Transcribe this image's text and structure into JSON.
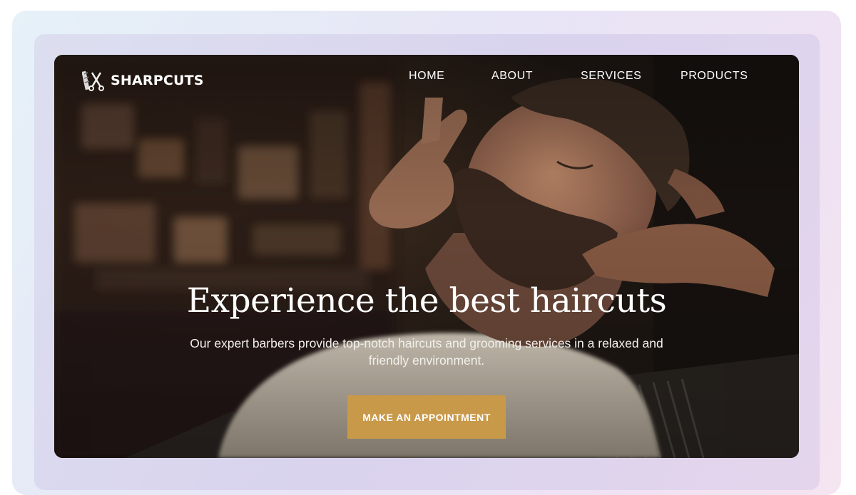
{
  "brand": {
    "name": "SHARPCUTS",
    "icon": "barber-scissors-icon"
  },
  "nav": {
    "items": [
      "HOME",
      "ABOUT",
      "SERVICES",
      "PRODUCTS"
    ]
  },
  "hero": {
    "title": "Experience the best haircuts",
    "subtitle": "Our expert barbers provide top-notch haircuts and grooming services in a relaxed and friendly environment.",
    "cta_label": "MAKE AN APPOINTMENT",
    "photo": "barber-grooming-beard-photo"
  },
  "colors": {
    "accent": "#c9994a",
    "text": "#ffffff",
    "hero_bg": "#1c1714"
  }
}
